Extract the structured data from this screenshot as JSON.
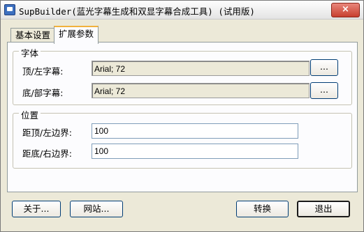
{
  "window": {
    "title": "SupBuilder(蓝光字幕生成和双显字幕合成工具) (试用版)",
    "close_label": "×"
  },
  "tabs": [
    {
      "label": "基本设置",
      "active": false
    },
    {
      "label": "扩展参数",
      "active": true
    }
  ],
  "font_group": {
    "title": "字体",
    "top_label": "顶/左字幕:",
    "top_value": "Arial; 72",
    "bottom_label": "底/部字幕:",
    "bottom_value": "Arial; 72",
    "browse_label": "..."
  },
  "position_group": {
    "title": "位置",
    "top_margin_label": "距顶/左边界:",
    "top_margin_value": "100",
    "bottom_margin_label": "距底/右边界:",
    "bottom_margin_value": "100"
  },
  "footer": {
    "about_label": "关于...",
    "website_label": "网站...",
    "convert_label": "转换",
    "exit_label": "退出"
  }
}
